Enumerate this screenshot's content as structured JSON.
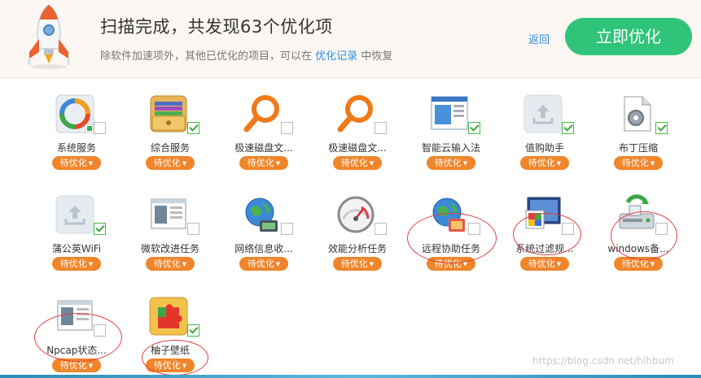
{
  "header": {
    "title": "扫描完成，共发现63个优化项",
    "subtitle_pre": "除软件加速项外，其他已优化的项目，可以在",
    "subtitle_link": "优化记录",
    "subtitle_post": "中恢复",
    "back": "返回",
    "optimize_button": "立即优化"
  },
  "items": [
    {
      "name": "系统服务",
      "tag": "待优化",
      "icon": "system-service-icon",
      "checked": false
    },
    {
      "name": "综合服务",
      "tag": "待优化",
      "icon": "integrated-service-icon",
      "checked": true
    },
    {
      "name": "极速磁盘文...",
      "tag": "待优化",
      "icon": "magnifier-icon",
      "checked": false
    },
    {
      "name": "极速磁盘文...",
      "tag": "待优化",
      "icon": "magnifier-icon",
      "checked": false
    },
    {
      "name": "智能云输入法",
      "tag": "待优化",
      "icon": "input-method-icon",
      "checked": true
    },
    {
      "name": "值购助手",
      "tag": "待优化",
      "icon": "upload-placeholder-icon",
      "checked": true
    },
    {
      "name": "布丁压缩",
      "tag": "待优化",
      "icon": "compress-icon",
      "checked": true
    },
    {
      "name": "蒲公英WiFi",
      "tag": "待优化",
      "icon": "upload-placeholder-icon",
      "checked": true
    },
    {
      "name": "微软改进任务",
      "tag": "待优化",
      "icon": "window-app-icon",
      "checked": false
    },
    {
      "name": "网络信息收...",
      "tag": "待优化",
      "icon": "globe-network-icon",
      "checked": false
    },
    {
      "name": "效能分析任务",
      "tag": "待优化",
      "icon": "gauge-icon",
      "checked": false
    },
    {
      "name": "远程协助任务",
      "tag": "待优化",
      "icon": "globe-network-icon",
      "checked": false
    },
    {
      "name": "系统过滤规...",
      "tag": "待优化",
      "icon": "color-monitor-icon",
      "checked": false
    },
    {
      "name": "windows备...",
      "tag": "待优化",
      "icon": "drive-sync-icon",
      "checked": false
    },
    {
      "name": "Npcap状态...",
      "tag": "待优化",
      "icon": "window-app-icon",
      "checked": false
    },
    {
      "name": "柚子壁纸",
      "tag": "待优化",
      "icon": "puzzle-icon",
      "checked": true
    }
  ],
  "watermark": "https://blog.csdn.net/hihbum"
}
